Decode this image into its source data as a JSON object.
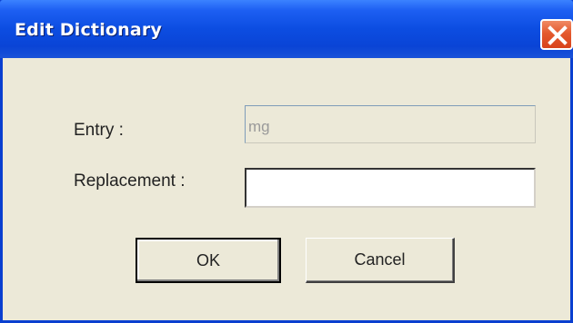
{
  "window": {
    "title": "Edit Dictionary",
    "close_icon": "close-icon"
  },
  "form": {
    "entry_label": "Entry :",
    "entry_value": "mg",
    "replacement_label": "Replacement :",
    "replacement_value": ""
  },
  "buttons": {
    "ok_label": "OK",
    "cancel_label": "Cancel"
  },
  "colors": {
    "titlebar": "#0a44d6",
    "dialog_bg": "#ece9d8",
    "close_button": "#e45a2e"
  }
}
